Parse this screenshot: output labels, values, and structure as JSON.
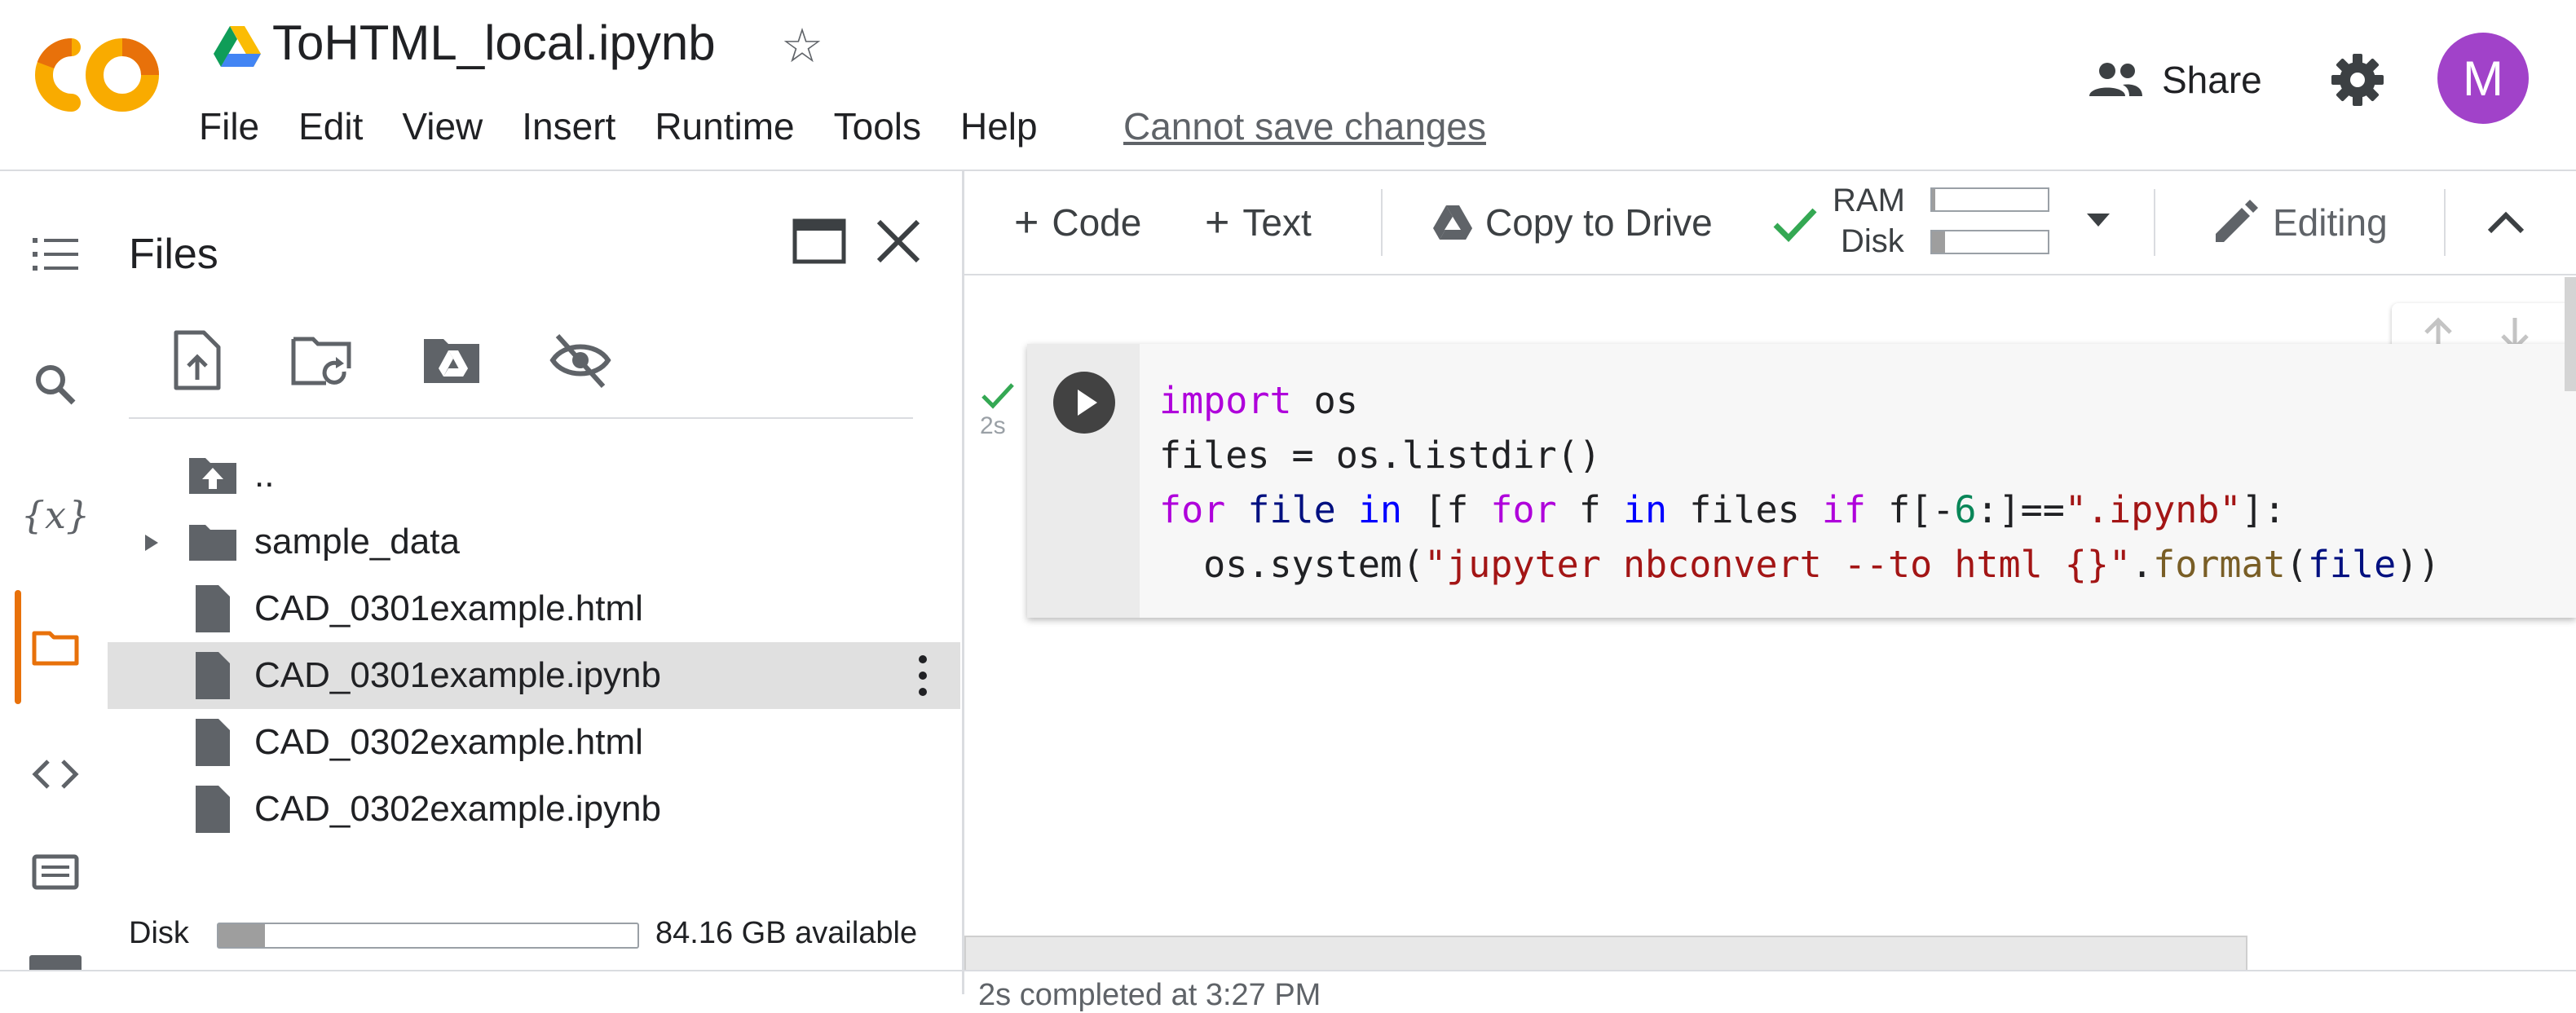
{
  "header": {
    "notebook_title": "ToHTML_local.ipynb",
    "menu": [
      "File",
      "Edit",
      "View",
      "Insert",
      "Runtime",
      "Tools",
      "Help"
    ],
    "save_status": "Cannot save changes",
    "share_label": "Share",
    "avatar_letter": "M",
    "logo_text": "CO"
  },
  "files_panel": {
    "title": "Files",
    "items": [
      {
        "name": "..",
        "type": "parent-folder"
      },
      {
        "name": "sample_data",
        "type": "folder",
        "expandable": true
      },
      {
        "name": "CAD_0301example.html",
        "type": "file"
      },
      {
        "name": "CAD_0301example.ipynb",
        "type": "file",
        "selected": true
      },
      {
        "name": "CAD_0302example.html",
        "type": "file"
      },
      {
        "name": "CAD_0302example.ipynb",
        "type": "file"
      }
    ],
    "disk_label": "Disk",
    "disk_available": "84.16 GB available",
    "disk_used_fraction": 0.11
  },
  "toolbar": {
    "add_code": "Code",
    "add_text": "Text",
    "copy_to_drive": "Copy to Drive",
    "ram_label": "RAM",
    "disk_label": "Disk",
    "ram_used_fraction": 0.03,
    "disk_used_fraction": 0.11,
    "editing": "Editing"
  },
  "cell": {
    "exec_time": "2s",
    "code_lines": [
      "import os",
      "files = os.listdir()",
      "for file in [f for f in files if f[-6:]==\".ipynb\"]:",
      "  os.system(\"jupyter nbconvert --to html {}\".format(file))"
    ]
  },
  "status_bar": {
    "text": "2s   completed at 3:27 PM"
  },
  "colors": {
    "accent_orange": "#e8710a",
    "avatar": "#a142c9",
    "success_green": "#34a853",
    "keyword": "#af00db",
    "builtin": "#0000ff",
    "string": "#a31515"
  }
}
